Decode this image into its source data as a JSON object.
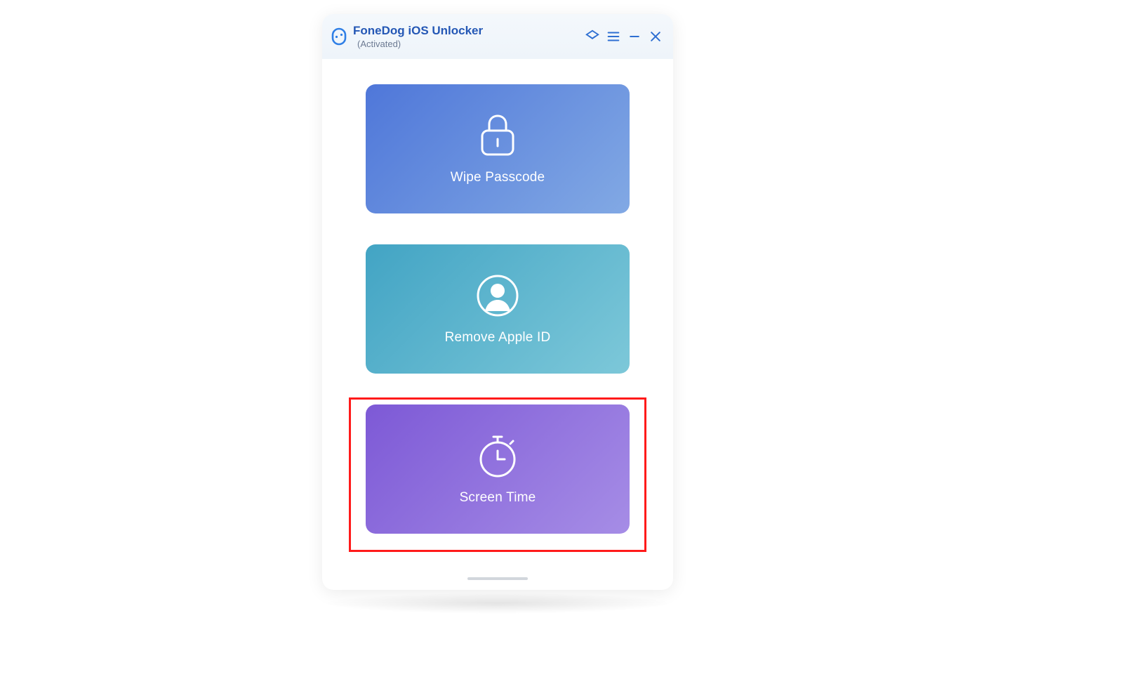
{
  "header": {
    "app_title": "FoneDog iOS Unlocker",
    "license_status": "(Activated)"
  },
  "options": {
    "wipe_passcode": {
      "label": "Wipe Passcode",
      "icon": "lock-icon"
    },
    "remove_apple_id": {
      "label": "Remove Apple ID",
      "icon": "avatar-icon"
    },
    "screen_time": {
      "label": "Screen Time",
      "icon": "stopwatch-icon"
    }
  },
  "colors": {
    "accent": "#2f6fd2",
    "highlight_border": "#ff1a1a"
  },
  "highlight": {
    "target": "screen_time"
  }
}
